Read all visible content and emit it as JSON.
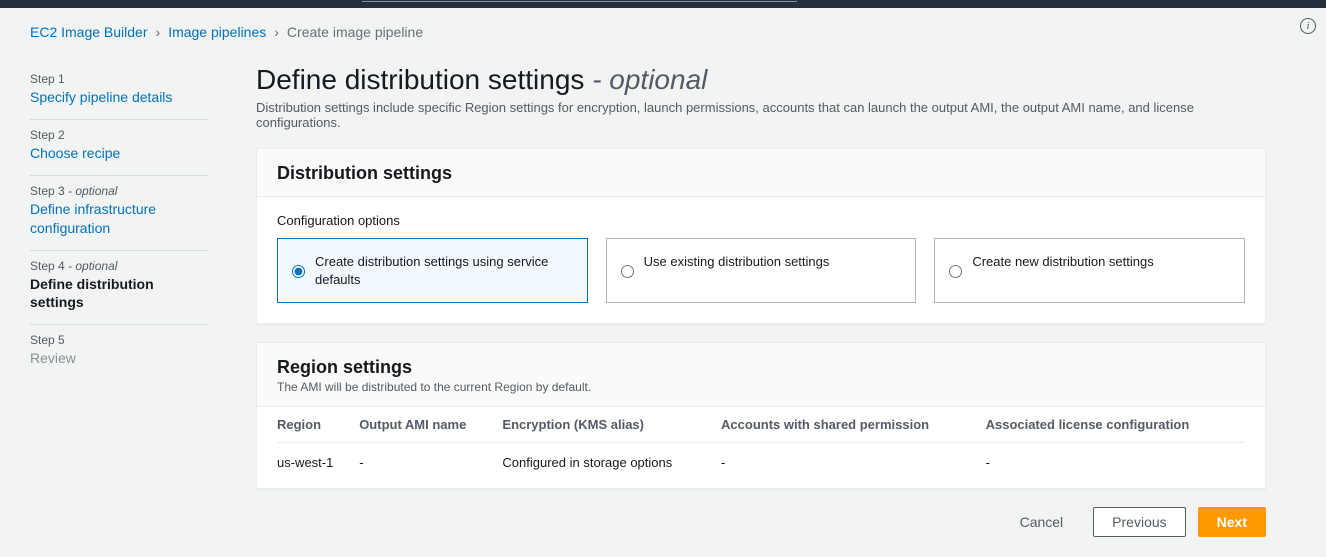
{
  "breadcrumb": {
    "service": "EC2 Image Builder",
    "section": "Image pipelines",
    "current": "Create image pipeline"
  },
  "steps": [
    {
      "num": "Step 1",
      "opt": "",
      "title": "Specify pipeline details",
      "state": "link"
    },
    {
      "num": "Step 2",
      "opt": "",
      "title": "Choose recipe",
      "state": "link"
    },
    {
      "num": "Step 3",
      "opt": " - optional",
      "title": "Define infrastructure configuration",
      "state": "link"
    },
    {
      "num": "Step 4",
      "opt": " - optional",
      "title": "Define distribution settings",
      "state": "active"
    },
    {
      "num": "Step 5",
      "opt": "",
      "title": "Review",
      "state": "disabled"
    }
  ],
  "page": {
    "title_main": "Define distribution settings ",
    "title_opt": "- optional",
    "description": "Distribution settings include specific Region settings for encryption, launch permissions, accounts that can launch the output AMI, the output AMI name, and license configurations."
  },
  "dist_panel": {
    "title": "Distribution settings",
    "cfg_label": "Configuration options",
    "options": [
      {
        "label": "Create distribution settings using service defaults",
        "selected": true
      },
      {
        "label": "Use existing distribution settings",
        "selected": false
      },
      {
        "label": "Create new distribution settings",
        "selected": false
      }
    ]
  },
  "region_panel": {
    "title": "Region settings",
    "sub": "The AMI will be distributed to the current Region by default.",
    "columns": [
      "Region",
      "Output AMI name",
      "Encryption (KMS alias)",
      "Accounts with shared permission",
      "Associated license configuration"
    ],
    "rows": [
      {
        "region": "us-west-1",
        "ami": "-",
        "enc": "Configured in storage options",
        "accts": "-",
        "lic": "-"
      }
    ]
  },
  "buttons": {
    "cancel": "Cancel",
    "previous": "Previous",
    "next": "Next"
  },
  "info_glyph": "i"
}
